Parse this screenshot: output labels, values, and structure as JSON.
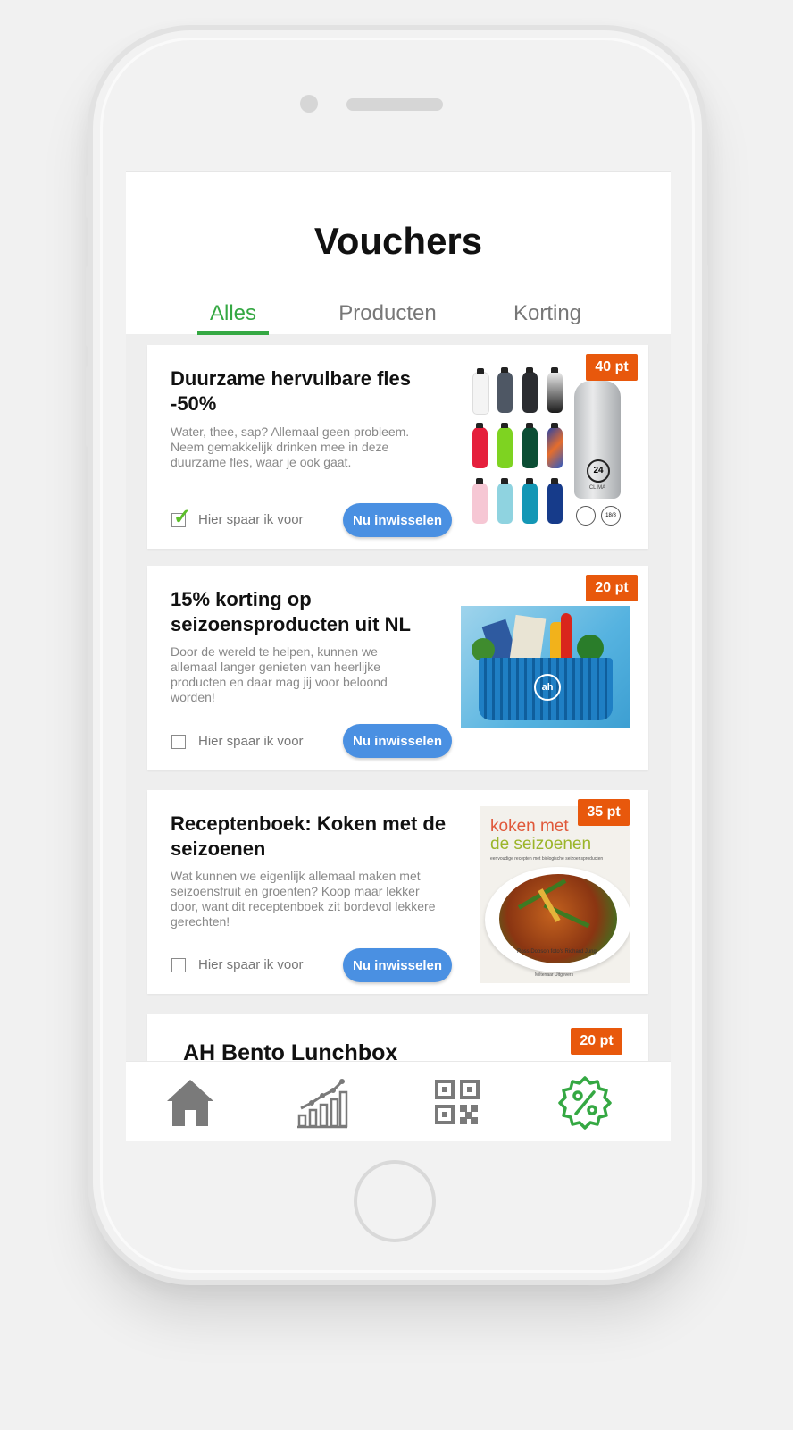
{
  "header": {
    "title": "Vouchers"
  },
  "tabs": [
    {
      "label": "Alles",
      "active": true
    },
    {
      "label": "Producten",
      "active": false
    },
    {
      "label": "Korting",
      "active": false
    }
  ],
  "vouchers": [
    {
      "title": "Duurzame hervulbare fles -50%",
      "description": "Water, thee, sap? Allemaal geen probleem. Neem gemakkelijk drinken mee in deze duurzame fles, waar je ook gaat.",
      "points": "40 pt",
      "save_label": "Hier spaar ik voor",
      "saving": true,
      "button_label": "Nu inwisselen"
    },
    {
      "title": "15% korting op seizoensproducten uit NL",
      "description": "Door de wereld te helpen, kunnen we allemaal langer genieten van heerlijke producten en daar mag jij voor beloond worden!",
      "points": "20 pt",
      "save_label": "Hier spaar ik voor",
      "saving": false,
      "button_label": "Nu inwisselen"
    },
    {
      "title": "Receptenboek: Koken met de seizoenen",
      "description": "Wat kunnen we eigenlijk allemaal maken met seizoensfruit en groenten? Koop maar lekker door, want dit receptenboek zit bordevol lekkere gerechten!",
      "points": "35 pt",
      "save_label": "Hier spaar ik voor",
      "saving": false,
      "button_label": "Nu inwisselen",
      "book": {
        "title_line1": "koken met",
        "title_line2": "de seizoenen",
        "subtitle": "eenvoudige recepten met biologische seizoensproducten",
        "authors": "Ross Dobson foto's Richard Jung",
        "publisher": "Miltenaar Uitgevers"
      }
    },
    {
      "title": "AH Bento Lunchbox",
      "points": "20 pt"
    }
  ],
  "bottle_image": {
    "logo": "24",
    "brand": "CLIMA",
    "seal": "18/8"
  },
  "basket_image": {
    "logo": "ah"
  },
  "nav": [
    {
      "icon": "home-icon",
      "active": false
    },
    {
      "icon": "chart-icon",
      "active": false
    },
    {
      "icon": "qr-code-icon",
      "active": false
    },
    {
      "icon": "discount-badge-icon",
      "active": true
    }
  ],
  "colors": {
    "accent_green": "#35a843",
    "button_blue": "#4a90e2",
    "badge_orange": "#e8580c",
    "nav_gray": "#7a7a7a"
  }
}
